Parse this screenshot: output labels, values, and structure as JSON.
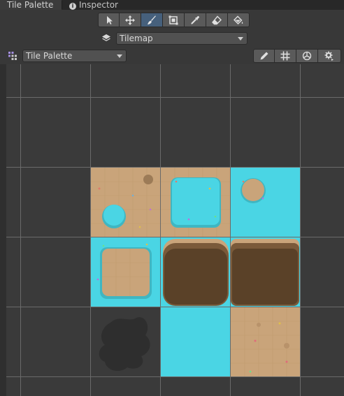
{
  "tabs": [
    {
      "label": "Tile Palette",
      "active": true
    },
    {
      "label": "Inspector",
      "active": false,
      "icon": "info-icon"
    }
  ],
  "tools": [
    {
      "name": "select-tool",
      "icon": "arrow-pointer-icon",
      "selected": false
    },
    {
      "name": "move-tool",
      "icon": "move-arrows-icon",
      "selected": false
    },
    {
      "name": "paint-tool",
      "icon": "brush-icon",
      "selected": true
    },
    {
      "name": "box-fill-tool",
      "icon": "box-fill-icon",
      "selected": false
    },
    {
      "name": "picker-tool",
      "icon": "eyedropper-icon",
      "selected": false
    },
    {
      "name": "erase-tool",
      "icon": "eraser-icon",
      "selected": false
    },
    {
      "name": "fill-tool",
      "icon": "paint-bucket-icon",
      "selected": false
    }
  ],
  "active_tilemap": {
    "value": "Tilemap",
    "icon": "layers-icon"
  },
  "palette_select": {
    "value": "Tile Palette",
    "icon": "palette-grid-icon"
  },
  "palette_buttons": [
    {
      "name": "edit-palette-button",
      "icon": "pencil-icon"
    },
    {
      "name": "toggle-grid-button",
      "icon": "grid-icon"
    },
    {
      "name": "gizmos-button",
      "icon": "gizmo-icon"
    },
    {
      "name": "settings-button",
      "icon": "gear-icon"
    }
  ],
  "colors": {
    "water": "#4ad5e4",
    "sand": "#c9a47a",
    "dark_dirt": "#5a4128",
    "shadow": "#2e2e2e"
  }
}
